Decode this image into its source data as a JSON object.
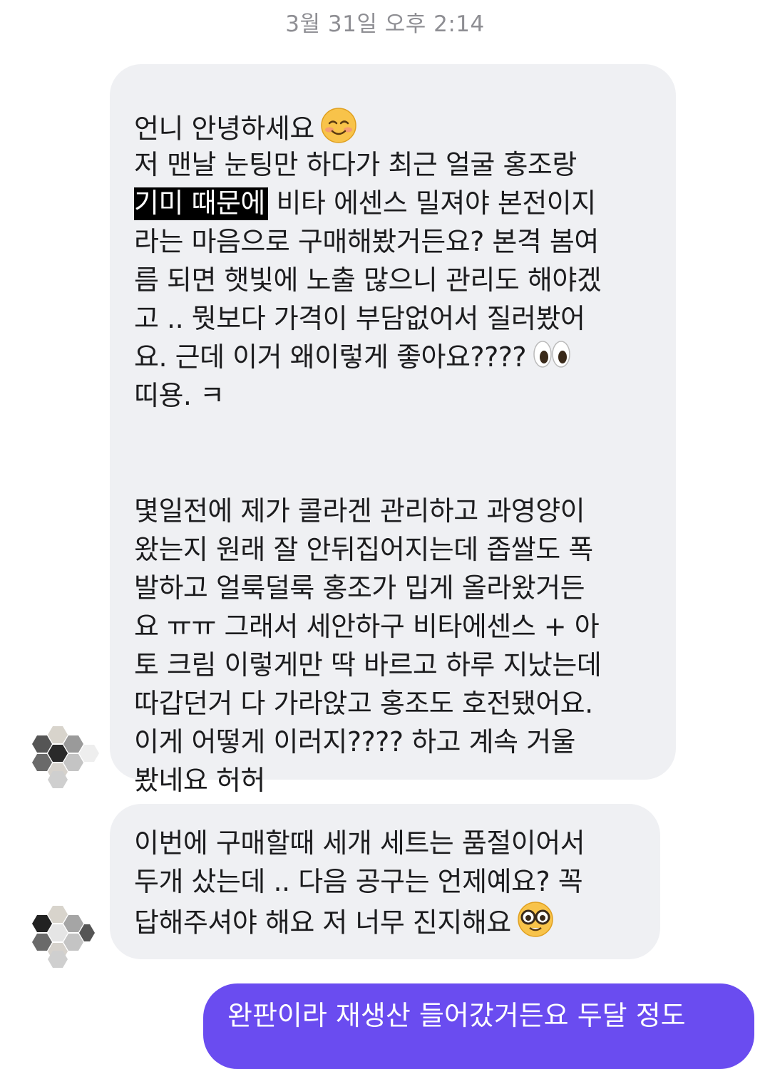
{
  "timestamp": "3월 31일 오후 2:14",
  "messages": {
    "first": {
      "lines": [
        "언니 안녕하세요",
        "저 맨날 눈팅만 하다가 최근 얼굴 홍조랑",
        "",
        "라는 마음으로 구매해봤거든요? 본격 봄여",
        "름 되면 햇빛에 노출 많으니 관리도 해야겠",
        "고 .. 뭣보다 가격이 부담없어서 질러봤어",
        "요. 근데 이거 왜이렇게 좋아요????",
        "띠용. ㅋ"
      ],
      "highlight": "기미 때문에",
      "line3_rest": " 비타 에센스 밀져야 본전이지",
      "lines2": [
        "몇일전에 제가 콜라겐 관리하고 과영양이",
        "왔는지 원래 잘 안뒤집어지는데 좁쌀도 폭",
        "발하고 얼룩덜룩 홍조가 밉게 올라왔거든",
        "요 ㅠㅠ 그래서 세안하구 비타에센스 + 아",
        "토 크림 이렇게만 딱 바르고 하루 지났는데",
        "따갑던거 다 가라앉고 홍조도 호전됐어요.",
        "이게 어떻게 이러지???? 하고 계속 거울",
        "봤네요 허허"
      ]
    },
    "second": {
      "lines": [
        "이번에 구매할때 세개 세트는 품절이어서",
        "두개 샀는데 .. 다음 공구는 언제예요? 꼭",
        "답해주셔야 해요 저 너무 진지해요"
      ]
    },
    "reply": {
      "text": "완판이라 재생산 들어갔거든요 두달 정도"
    }
  },
  "icons": {
    "smile": "smiling-face-icon",
    "eyes": "eyes-icon",
    "nerd": "nerd-face-icon",
    "avatar": "blurred-avatar"
  },
  "colors": {
    "incoming_bubble": "#eff0f3",
    "outgoing_bubble": "#6a4cf0",
    "timestamp": "#8e8e93"
  }
}
